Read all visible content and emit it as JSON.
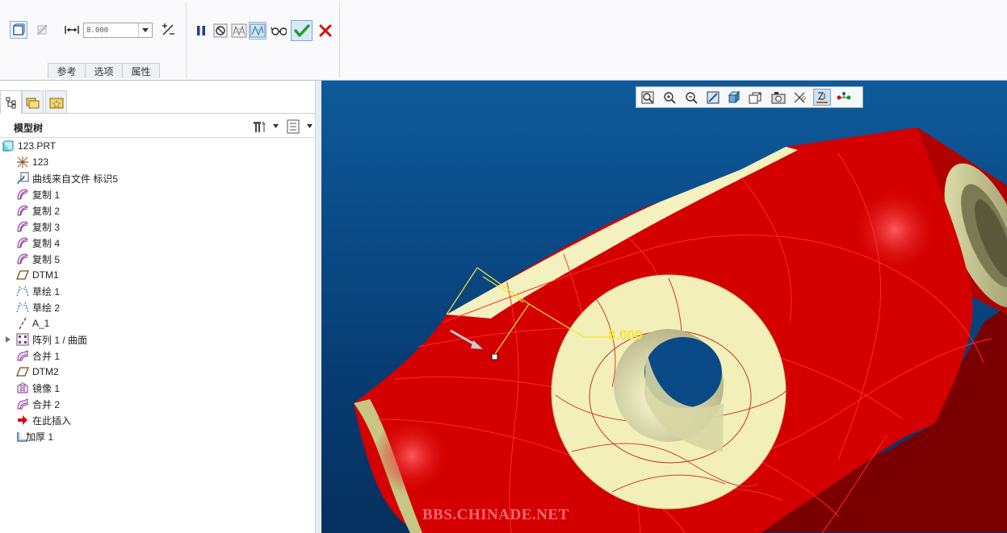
{
  "dashboard": {
    "thickness_value": "8.000",
    "tabs": [
      "参考",
      "选项",
      "属性"
    ]
  },
  "navigator": {
    "title": "模型树",
    "items": [
      {
        "label": "123.PRT",
        "icon": "part-icon"
      },
      {
        "label": "123",
        "icon": "coordinate-system-icon"
      },
      {
        "label": "曲线来自文件 标识5",
        "icon": "curve-from-file-icon"
      },
      {
        "label": "复制 1",
        "icon": "copy-surface-icon"
      },
      {
        "label": "复制 2",
        "icon": "copy-surface-icon"
      },
      {
        "label": "复制 3",
        "icon": "copy-surface-icon"
      },
      {
        "label": "复制 4",
        "icon": "copy-surface-icon"
      },
      {
        "label": "复制 5",
        "icon": "copy-surface-icon"
      },
      {
        "label": "DTM1",
        "icon": "datum-plane-icon"
      },
      {
        "label": "草绘 1",
        "icon": "sketch-icon"
      },
      {
        "label": "草绘 2",
        "icon": "sketch-icon"
      },
      {
        "label": "A_1",
        "icon": "datum-axis-icon"
      },
      {
        "label": "阵列 1 / 曲面",
        "icon": "pattern-icon"
      },
      {
        "label": "合并 1",
        "icon": "merge-icon"
      },
      {
        "label": "DTM2",
        "icon": "datum-plane-icon"
      },
      {
        "label": "镜像 1",
        "icon": "mirror-icon"
      },
      {
        "label": "合并 2",
        "icon": "merge-icon"
      },
      {
        "label": "在此插入",
        "icon": "insert-here-arrow-icon"
      },
      {
        "label": "加厚 1",
        "icon": "thicken-icon"
      }
    ]
  },
  "graphics": {
    "dimension_value": "8.000",
    "watermark": "BBS.CHINADE.NET"
  },
  "colors": {
    "part_red": "#d40000",
    "part_cream": "#f2f0b8",
    "background_blue": "#0a4a86",
    "confirm_green": "#1e9e2a",
    "cancel_red": "#cc1111",
    "dimension_yellow": "#f2e63a"
  }
}
